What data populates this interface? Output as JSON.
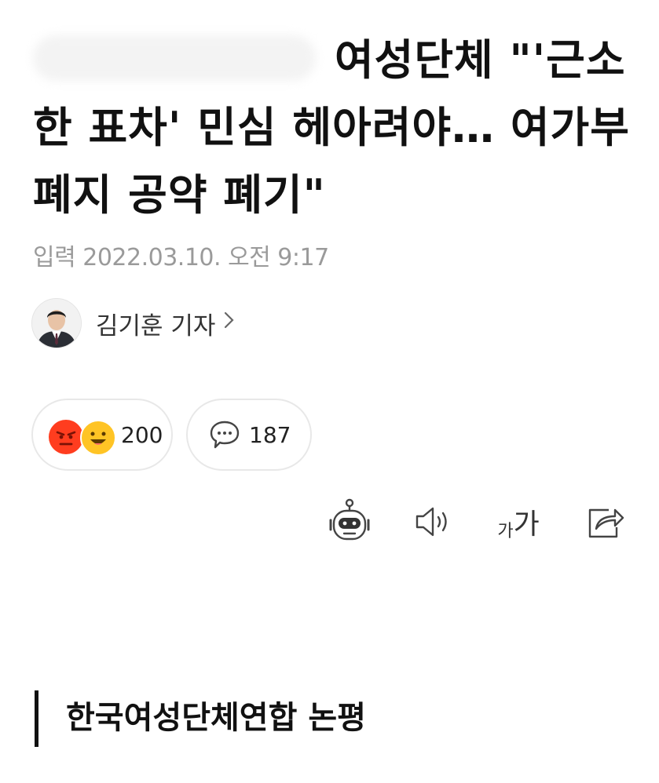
{
  "article": {
    "headline": "여성단체 \"'근소한 표차' 민심 헤아려야… 여가부폐지 공약 폐기\"",
    "dateline": "입력 2022.03.10. 오전 9:17",
    "reporter": "김기훈 기자"
  },
  "reactions": {
    "reaction_count": "200",
    "comment_count": "187"
  },
  "toolbar": {
    "font_small": "가",
    "font_big": "가"
  },
  "section": {
    "title": "한국여성단체연합 논평"
  },
  "colors": {
    "angry": "#ff3d1f",
    "happy": "#ffc425",
    "muted_text": "#9a9a9a"
  },
  "icons": [
    "robot-icon",
    "speaker-icon",
    "font-size-icon",
    "share-icon",
    "comment-bubble-icon",
    "chevron-right-icon"
  ]
}
